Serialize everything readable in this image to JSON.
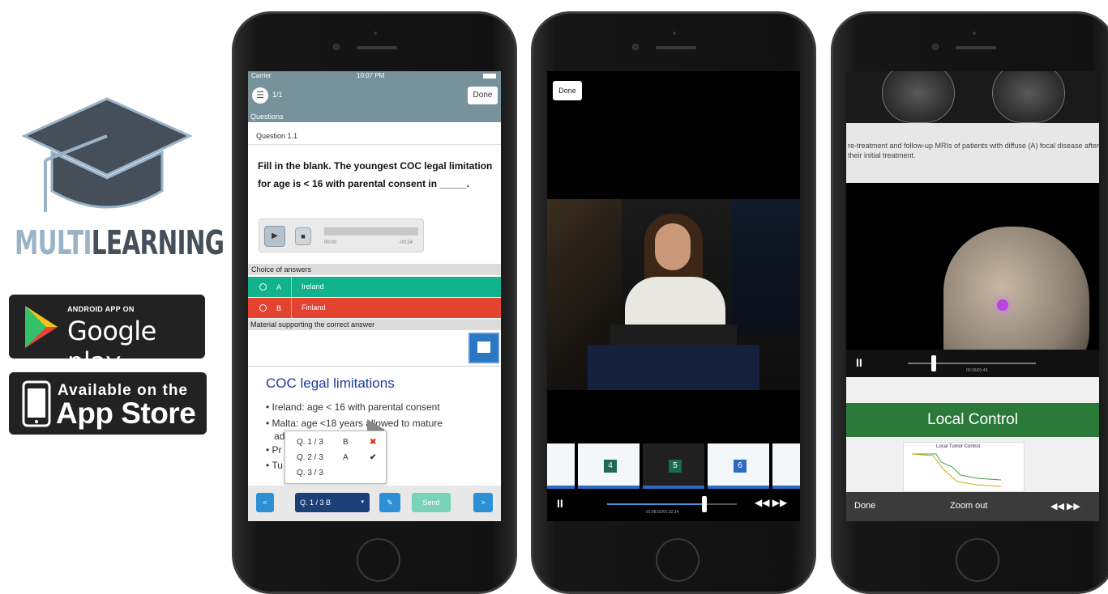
{
  "brand": {
    "name_part1": "MULTI",
    "name_part2": "LEARNING"
  },
  "badges": {
    "google_play": {
      "small": "ANDROID APP ON",
      "big": "Google play"
    },
    "app_store": {
      "small": "Available on the",
      "big": "App Store"
    }
  },
  "phone1": {
    "status": {
      "carrier": "Carrier",
      "time": "10:07 PM"
    },
    "nav": {
      "page": "1/1",
      "done": "Done"
    },
    "section_questions": "Questions",
    "question_number": "Question 1.1",
    "question_text": "Fill in the blank. The youngest COC legal limitation for age is < 16 with parental consent in _____.",
    "audio": {
      "elapsed": "00:00",
      "remaining": "-00:24",
      "play": "▶",
      "stop": "■"
    },
    "section_choices": "Choice of answers",
    "answers": [
      {
        "letter": "A",
        "text": "Ireland",
        "status": "correct"
      },
      {
        "letter": "B",
        "text": "Finland",
        "status": "wrong"
      }
    ],
    "section_material": "Material supporting the correct answer",
    "slide": {
      "title": "COC legal limitations",
      "bullets": [
        "• Ireland: age < 16 with parental consent",
        "• Malta: age <18 years allowed to mature",
        "ad",
        "• Pr                             parental consent",
        "• Tu"
      ]
    },
    "popup": [
      {
        "q": "Q. 1 / 3",
        "a": "B",
        "mark": "✖"
      },
      {
        "q": "Q. 2 / 3",
        "a": "A",
        "mark": "✔"
      },
      {
        "q": "Q. 3 / 3",
        "a": "",
        "mark": ""
      }
    ],
    "footer": {
      "prev": "<",
      "select": "Q. 1 / 3   B",
      "select_caret": "▾",
      "comment": "✎",
      "send": "Send",
      "next": ">"
    }
  },
  "phone2": {
    "done": "Done",
    "thumbnails": [
      "",
      "4",
      "5",
      "6",
      ""
    ],
    "controls": {
      "pause": "II",
      "time": "01:08:02/01:32:14",
      "skip": "◀◀ ▶▶"
    },
    "progress": 0.75
  },
  "phone3": {
    "caption": "re-treatment and follow-up MRIs of patients with diffuse (A) focal disease after their initial treatment.",
    "controls": {
      "pause": "II",
      "time": "00:16/01:43"
    },
    "slide_title": "Local Control",
    "chart_title": "Local Tumor Control",
    "footer": {
      "done": "Done",
      "zoom": "Zoom out",
      "skip": "◀◀ ▶▶"
    },
    "progress": 0.2
  }
}
